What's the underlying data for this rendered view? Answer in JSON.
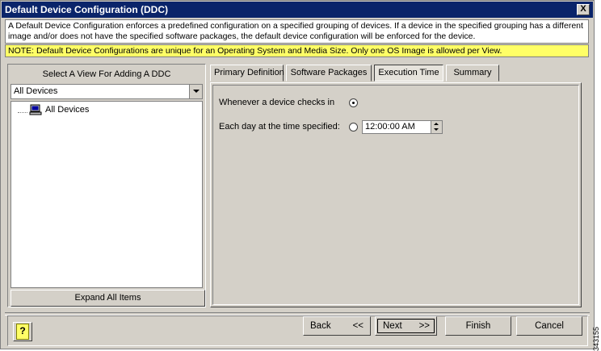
{
  "window": {
    "title": "Default Device Configuration (DDC)",
    "close_label": "X"
  },
  "description": "A Default Device Configuration enforces a predefined configuration on a specified grouping of devices.  If a device in the specified grouping has a different image and/or does not have the specified software packages, the default device configuration will be enforced for the device.",
  "note": "NOTE: Default Device Configurations are unique for an Operating System and Media Size.  Only one OS Image is allowed per View.",
  "left_panel": {
    "view_label": "Select A View For Adding A DDC",
    "dropdown_value": "All Devices",
    "tree_items": [
      {
        "label": "All Devices",
        "icon": "computer-icon"
      }
    ],
    "expand_button": "Expand All Items"
  },
  "tabs": [
    {
      "label": "Primary Definition",
      "active": false
    },
    {
      "label": "Software Packages",
      "active": false
    },
    {
      "label": "Execution Time",
      "active": true
    },
    {
      "label": "Summary",
      "active": false
    }
  ],
  "execution_time": {
    "option_checkin_label": "Whenever a device checks in",
    "option_checkin_selected": true,
    "option_time_label": "Each day at the time specified:",
    "option_time_selected": false,
    "time_value": "12:00:00 AM"
  },
  "buttons": {
    "help_label": "?",
    "back_label": "Back",
    "back_arrows": "<<",
    "next_label": "Next",
    "next_arrows": ">>",
    "finish_label": "Finish",
    "cancel_label": "Cancel"
  },
  "watermark": "343155"
}
